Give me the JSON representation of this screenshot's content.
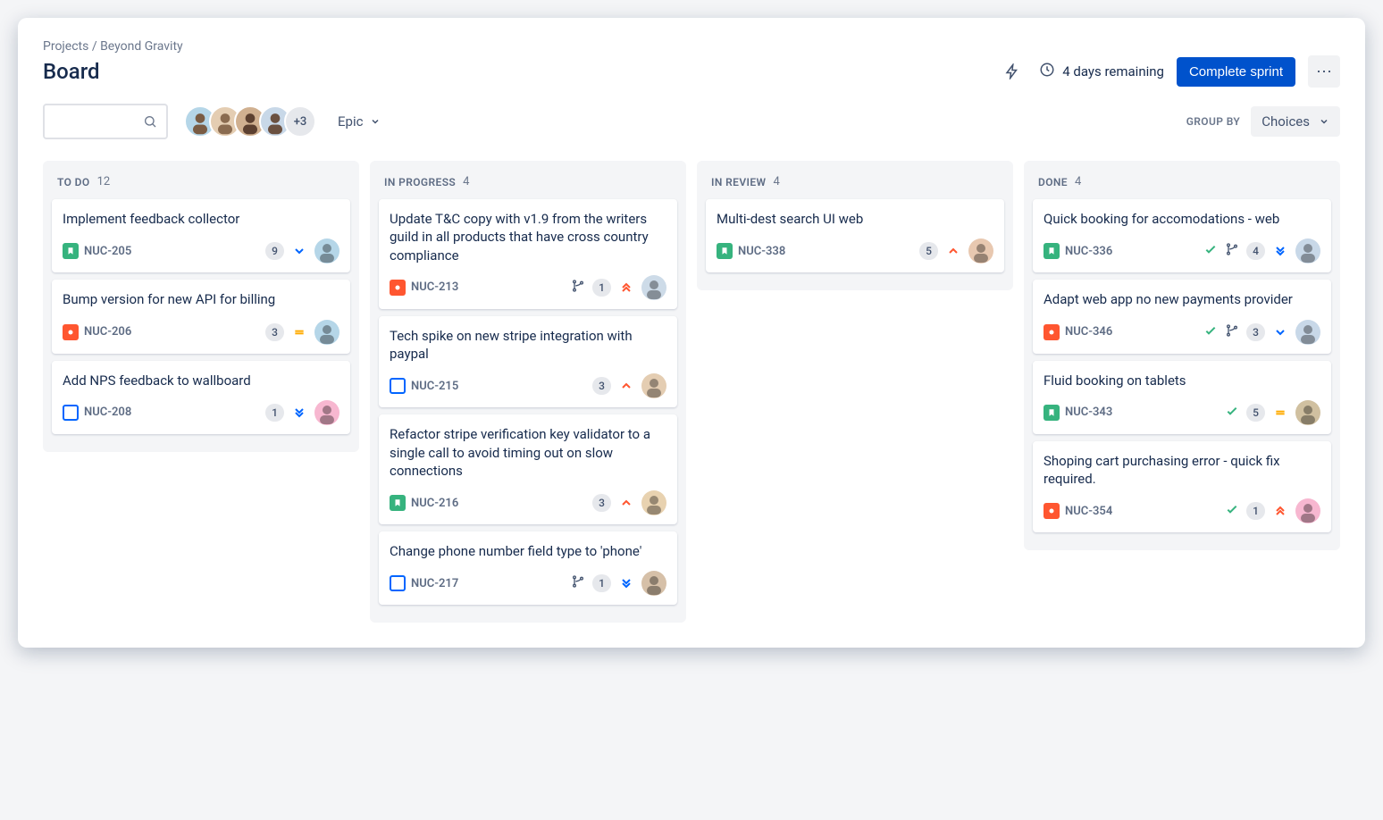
{
  "breadcrumb": {
    "root": "Projects",
    "project": "Beyond Gravity"
  },
  "page_title": "Board",
  "sprint": {
    "remaining_label": "4 days remaining",
    "complete_label": "Complete sprint"
  },
  "filters": {
    "epic_label": "Epic",
    "group_by_label": "GROUP BY",
    "group_by_value": "Choices",
    "avatar_overflow": "+3"
  },
  "avatar_colors": [
    "#d0e8f2",
    "#f2d0d0",
    "#ead0f2",
    "#d0f2d8"
  ],
  "columns": [
    {
      "title": "TO DO",
      "count": "12",
      "cards": [
        {
          "summary": "Implement feedback collector",
          "type": "story",
          "key": "NUC-205",
          "estimate": "9",
          "priority": "low",
          "assignee_color": "#b5d6e8"
        },
        {
          "summary": "Bump version for new API for billing",
          "type": "bug",
          "key": "NUC-206",
          "estimate": "3",
          "priority": "medium",
          "assignee_color": "#b5d6e8"
        },
        {
          "summary": "Add NPS feedback to wallboard",
          "type": "task",
          "key": "NUC-208",
          "estimate": "1",
          "priority": "lowest",
          "assignee_color": "#f7b7d0"
        }
      ]
    },
    {
      "title": "IN PROGRESS",
      "count": "4",
      "cards": [
        {
          "summary": "Update T&C copy with v1.9 from the writers guild in all products that have cross country compliance",
          "type": "bug",
          "key": "NUC-213",
          "branch": true,
          "estimate": "1",
          "priority": "highest",
          "assignee_color": "#cddbe8"
        },
        {
          "summary": "Tech spike on new stripe integration with paypal",
          "type": "task",
          "key": "NUC-215",
          "estimate": "3",
          "priority": "high",
          "assignee_color": "#e4cdb2"
        },
        {
          "summary": "Refactor stripe verification key validator to a single call to avoid timing out on slow connections",
          "type": "story",
          "key": "NUC-216",
          "estimate": "3",
          "priority": "high",
          "assignee_color": "#e8d2b0"
        },
        {
          "summary": "Change phone number field type to 'phone'",
          "type": "task",
          "key": "NUC-217",
          "branch": true,
          "estimate": "1",
          "priority": "lowest",
          "assignee_color": "#d6c0a8"
        }
      ]
    },
    {
      "title": "IN REVIEW",
      "count": "4",
      "cards": [
        {
          "summary": "Multi-dest search UI web",
          "type": "story",
          "key": "NUC-338",
          "estimate": "5",
          "priority": "high",
          "assignee_color": "#e8c8b0"
        }
      ]
    },
    {
      "title": "DONE",
      "count": "4",
      "cards": [
        {
          "summary": "Quick booking for accomodations - web",
          "type": "story",
          "key": "NUC-336",
          "done": true,
          "branch": true,
          "estimate": "4",
          "priority": "lowest",
          "assignee_color": "#c8d8e8"
        },
        {
          "summary": "Adapt web app no new payments provider",
          "type": "bug",
          "key": "NUC-346",
          "done": true,
          "branch": true,
          "estimate": "3",
          "priority": "low",
          "assignee_color": "#c8d8e8"
        },
        {
          "summary": "Fluid booking on tablets",
          "type": "story",
          "key": "NUC-343",
          "done": true,
          "estimate": "5",
          "priority": "medium",
          "assignee_color": "#d0c0a0"
        },
        {
          "summary": "Shoping cart purchasing error - quick fix required.",
          "type": "bug",
          "key": "NUC-354",
          "done": true,
          "estimate": "1",
          "priority": "highest",
          "assignee_color": "#f7b7d0"
        }
      ]
    }
  ]
}
